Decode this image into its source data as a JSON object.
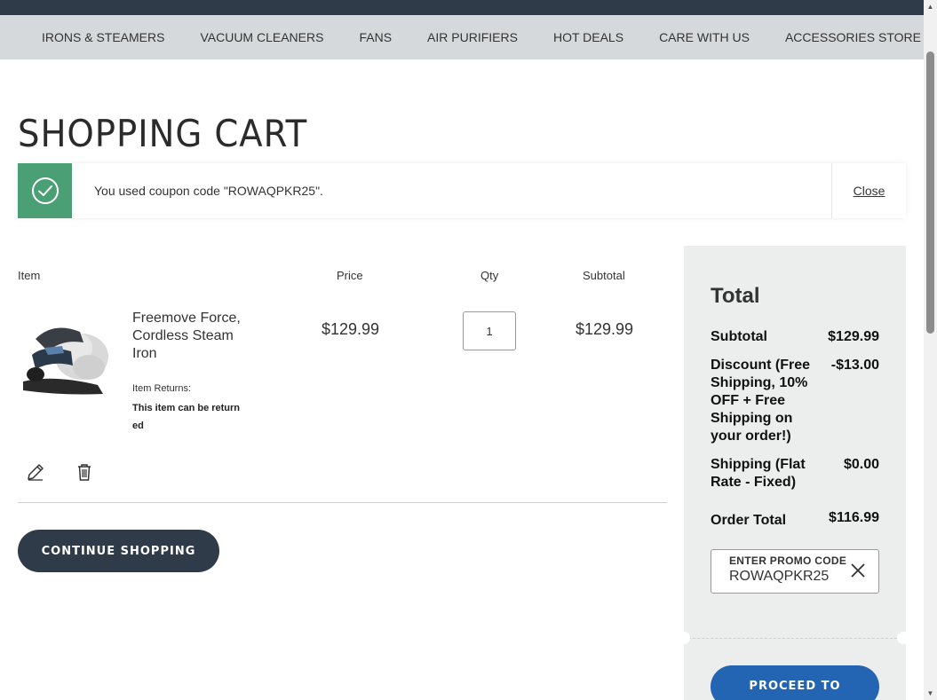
{
  "nav": {
    "items": [
      {
        "label": "IRONS & STEAMERS"
      },
      {
        "label": "VACUUM CLEANERS"
      },
      {
        "label": "FANS"
      },
      {
        "label": "AIR PURIFIERS"
      },
      {
        "label": "HOT DEALS"
      },
      {
        "label": "CARE WITH US"
      },
      {
        "label": "ACCESSORIES STORE"
      }
    ]
  },
  "page": {
    "title": "SHOPPING CART"
  },
  "message": {
    "icon": "check-circle-icon",
    "text": "You used coupon code \"ROWAQPKR25\".",
    "close_label": "Close",
    "color": "#4aa074"
  },
  "cart": {
    "headers": {
      "item": "Item",
      "price": "Price",
      "qty": "Qty",
      "subtotal": "Subtotal"
    },
    "items": [
      {
        "name": "Freemove Force, Cordless Steam Iron",
        "returns_label": "Item Returns:",
        "returns_value": "This item can be returned",
        "price": "$129.99",
        "qty": "1",
        "subtotal": "$129.99"
      }
    ],
    "continue_label": "CONTINUE SHOPPING"
  },
  "summary": {
    "title": "Total",
    "subtotal_label": "Subtotal",
    "subtotal_value": "$129.99",
    "discount_label": "Discount (Free Shipping, 10% OFF + Free Shipping on your order!)",
    "discount_value": "-$13.00",
    "shipping_label": "Shipping (Flat Rate - Fixed)",
    "shipping_value": "$0.00",
    "order_total_label": "Order Total",
    "order_total_value": "$116.99",
    "promo_label": "ENTER PROMO CODE",
    "promo_value": "ROWAQPKR25",
    "proceed_label": "PROCEED TO"
  },
  "colors": {
    "nav_dark": "#2f3b48",
    "primary": "#2364b3",
    "success": "#4aa074"
  }
}
